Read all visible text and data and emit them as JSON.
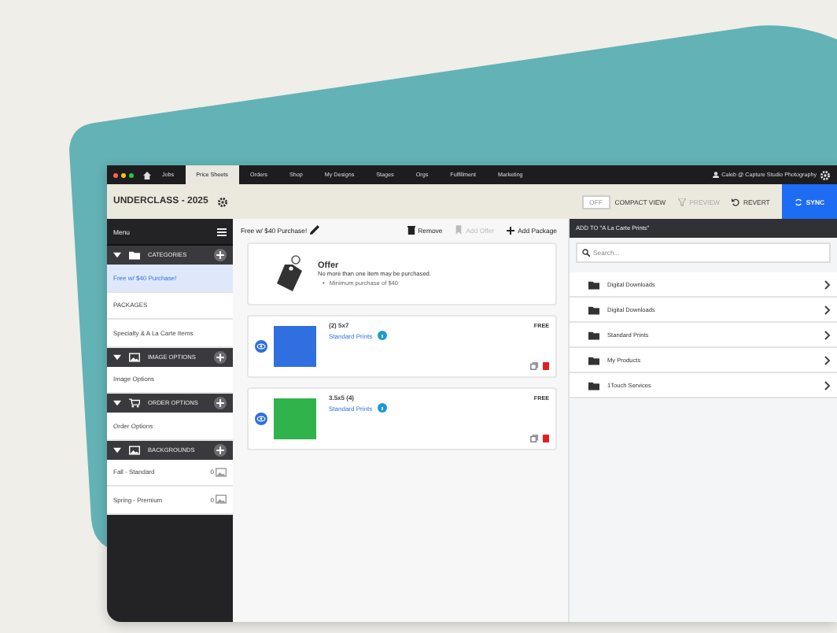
{
  "nav": {
    "tabs": [
      {
        "label": "Jobs",
        "selected": false
      },
      {
        "label": "Price Sheets",
        "selected": true
      },
      {
        "label": "Orders",
        "selected": false
      },
      {
        "label": "Shop",
        "selected": false
      },
      {
        "label": "My Designs",
        "selected": false
      },
      {
        "label": "Stages",
        "selected": false
      },
      {
        "label": "Orgs",
        "selected": false
      },
      {
        "label": "Fulfillment",
        "selected": false
      },
      {
        "label": "Marketing",
        "selected": false
      }
    ],
    "user": "Caleb @ Capture Studio Photography"
  },
  "header": {
    "title": "UNDERCLASS - 2025",
    "toggle": {
      "label": "OFF",
      "on": false
    },
    "compact_view": "COMPACT VIEW",
    "preview": {
      "label": "PREVIEW",
      "disabled": true
    },
    "revert": {
      "label": "REVERT",
      "disabled": false
    },
    "sync": "SYNC"
  },
  "sidebar": {
    "title": "Menu",
    "sections": [
      {
        "label": "CATEGORIES",
        "kind": "folder",
        "expanded": true,
        "items": [
          {
            "label": "Free w/ $40 Purchase!",
            "selected": true
          },
          {
            "label": "PACKAGES",
            "selected": false
          },
          {
            "label": "Specialty & A La Carte Items",
            "selected": false
          }
        ]
      },
      {
        "label": "IMAGE OPTIONS",
        "kind": "image",
        "expanded": true,
        "items": [
          {
            "label": "Image Options",
            "selected": false
          }
        ]
      },
      {
        "label": "ORDER OPTIONS",
        "kind": "cart",
        "expanded": true,
        "items": [
          {
            "label": "Order Options",
            "selected": false
          }
        ]
      },
      {
        "label": "BACKGROUNDS",
        "kind": "image",
        "expanded": true,
        "items": [
          {
            "label": "Fall - Standard",
            "selected": false,
            "count": "0"
          },
          {
            "label": "Spring - Premium",
            "selected": false,
            "count": "0"
          }
        ]
      }
    ]
  },
  "main": {
    "title": "Free w/ $40 Purchase!",
    "actions": [
      {
        "kind": "remove",
        "label": "Remove",
        "disabled": false
      },
      {
        "kind": "offer",
        "label": "Add Offer",
        "disabled": true
      },
      {
        "kind": "add",
        "label": "Add Package",
        "disabled": false
      }
    ],
    "offer": {
      "title": "Offer",
      "description": "No more than one item may be purchased.",
      "rules": [
        {
          "bullet": "•",
          "text": "Minimum purchase of $40"
        }
      ]
    },
    "packages": [
      {
        "name": "(2) 5x7",
        "category": "Standard Prints",
        "price": "FREE",
        "color": "#2f6fe0"
      },
      {
        "name": "3.5x5 (4)",
        "category": "Standard Prints",
        "price": "FREE",
        "color": "#2fb34a"
      }
    ]
  },
  "panel": {
    "title": "ADD TO \"A La Carte Prints\"",
    "search_placeholder": "Search...",
    "items": [
      "Digital Downloads",
      "Digital Downloads",
      "Standard Prints",
      "My Products",
      "1Touch Services"
    ]
  }
}
